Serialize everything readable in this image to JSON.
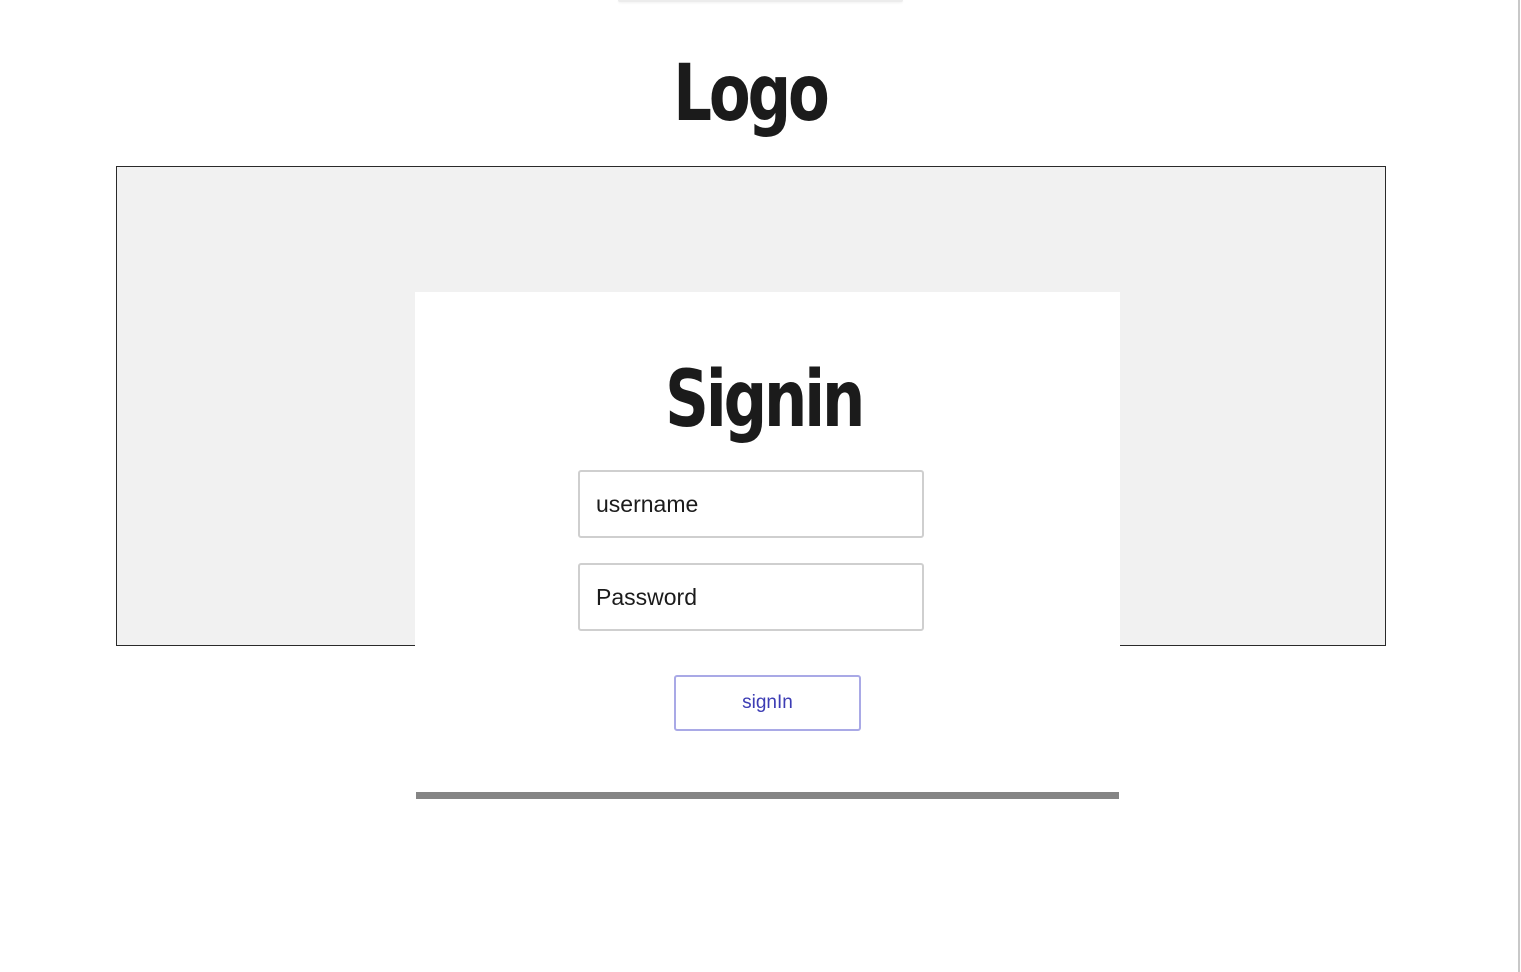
{
  "header": {
    "logo_text": "Logo"
  },
  "signin_card": {
    "title": "Signin",
    "username_field": {
      "value": "",
      "placeholder": "username"
    },
    "password_field": {
      "value": "",
      "placeholder": "Password"
    },
    "submit_label": "signIn"
  },
  "colors": {
    "hero_background": "#f1f1f1",
    "button_border": "#a9a9e6",
    "button_text": "#3c3cb4",
    "divider": "#858585"
  }
}
